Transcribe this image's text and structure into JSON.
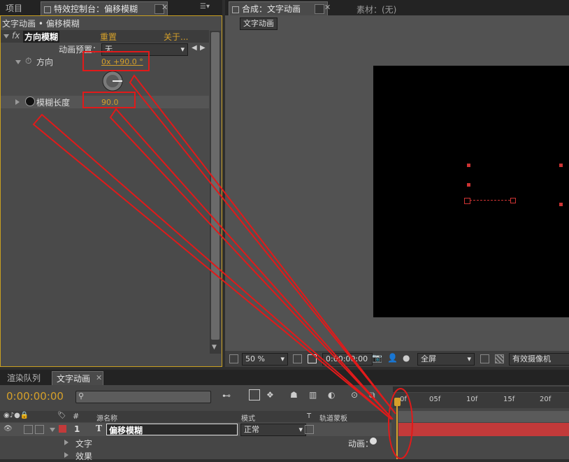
{
  "left_tabs": {
    "project": "项目",
    "effect_controls": "特效控制台：偏移模糊"
  },
  "breadcrumb": "文字动画 • 偏移模糊",
  "effect": {
    "fx": "fx",
    "name": "方向模糊",
    "reset": "重置",
    "about": "关于..."
  },
  "preset": {
    "label": "动画预置：",
    "value": "无"
  },
  "direction": {
    "label": "方向",
    "value": "0x +90.0 °"
  },
  "blur_length": {
    "label": "模糊长度",
    "value": "90.0"
  },
  "right_tabs": {
    "composition": "合成：文字动画",
    "footage": "素材：(无)"
  },
  "comp_button": "文字动画",
  "viewer_footer": {
    "zoom": "50 %",
    "timecode": "0:00:00:00",
    "resolution": "全屏",
    "camera": "有效摄像机"
  },
  "bottom_tabs": {
    "render_queue": "渲染队列",
    "comp": "文字动画"
  },
  "timeline": {
    "timecode": "0:00:00:00",
    "headers": {
      "num": "#",
      "source": "源名称",
      "mode": "模式",
      "t": "T",
      "track_matte": "轨道蒙板"
    },
    "layer": {
      "index": "1",
      "type": "T",
      "name": "偏移模糊",
      "mode": "正常"
    },
    "sub_text": "文字",
    "sub_effect": "效果",
    "animate": "动画：",
    "ruler": [
      "0f",
      "05f",
      "10f",
      "15f",
      "20f"
    ]
  },
  "colors": {
    "accent": "#d5a02a",
    "annotation": "#e11a1a",
    "layer_bar": "#c33a3a"
  }
}
